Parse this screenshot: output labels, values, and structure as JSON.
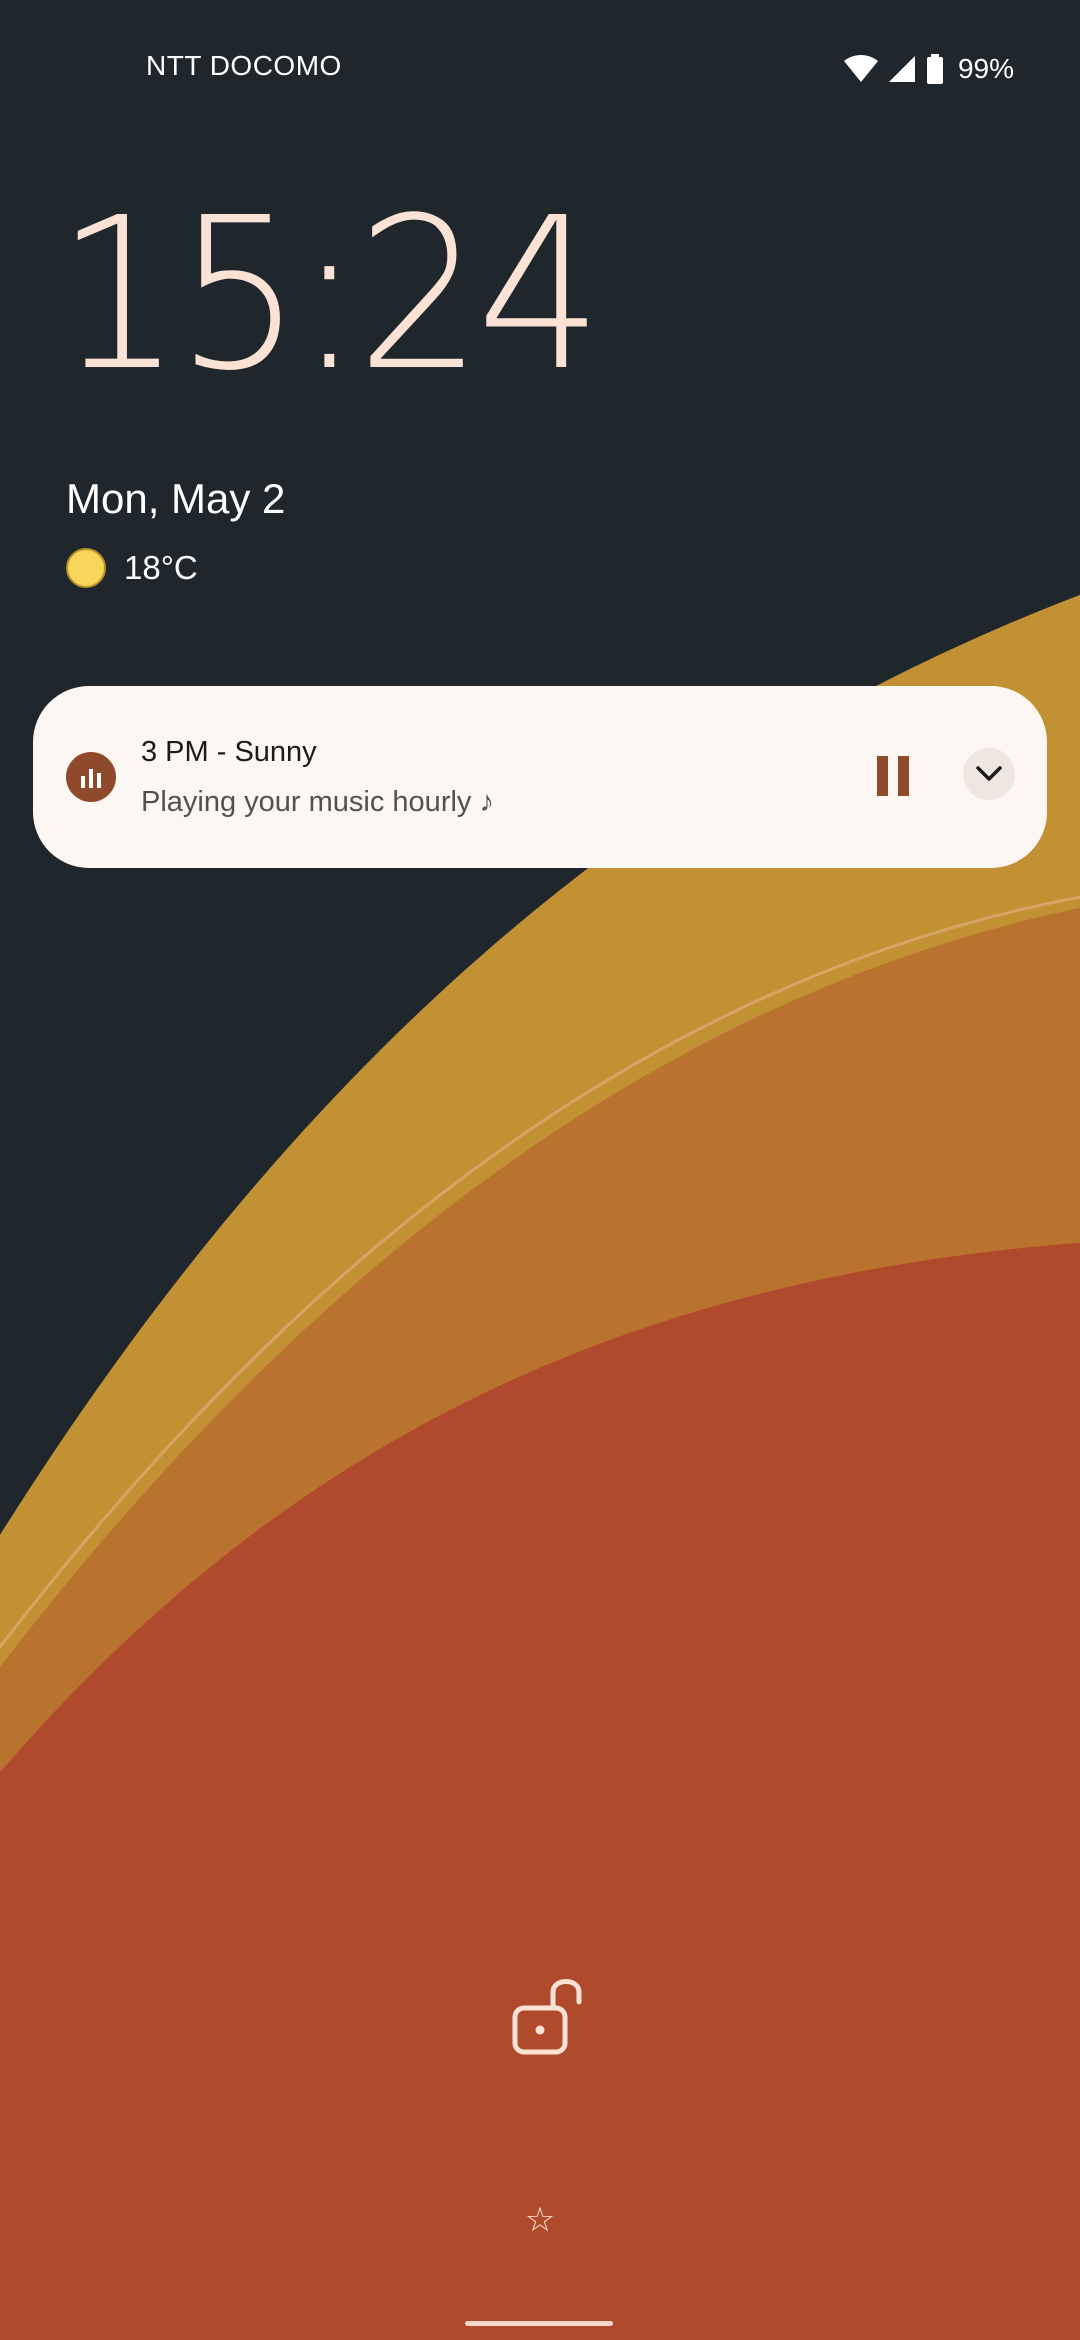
{
  "status_bar": {
    "carrier": "NTT DOCOMO",
    "battery_percent": "99%",
    "icons": [
      "wifi-icon",
      "cell-signal-icon",
      "battery-icon"
    ]
  },
  "lockscreen": {
    "time": "15:24",
    "date": "Mon, May 2",
    "weather": {
      "icon": "sun-icon",
      "temperature": "18°C"
    }
  },
  "notification": {
    "app_icon": "bar-chart-icon",
    "title": "3 PM - Sunny",
    "text": "Playing your music hourly ♪",
    "actions": [
      "pause-icon",
      "chevron-down-icon"
    ]
  },
  "bottom": {
    "lock_icon": "unlocked-padlock-icon",
    "star_glyph": "☆"
  },
  "colors": {
    "background": "#1f262c",
    "clock": "#fbe2d5",
    "notification_bg": "#fcf7f3",
    "accent_brown": "#8e4a2a",
    "wallpaper_gold": "#c29133",
    "wallpaper_orange": "#ba722f",
    "wallpaper_red": "#b04a2c"
  }
}
